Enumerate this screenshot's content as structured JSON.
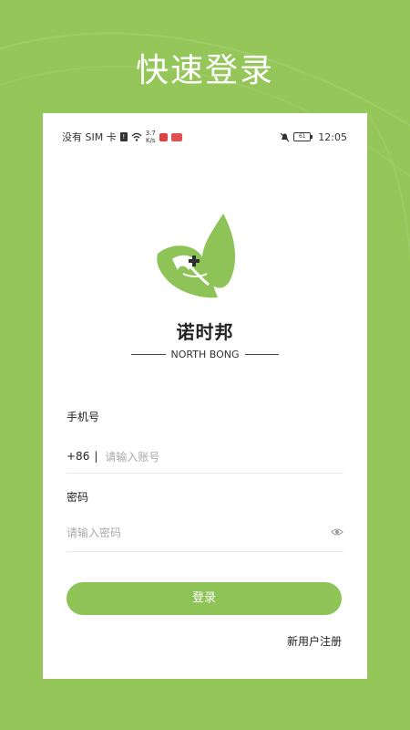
{
  "header": {
    "title": "快速登录"
  },
  "status_bar": {
    "carrier": "没有 SIM 卡",
    "speed_top": "3.7",
    "speed_bottom": "K/s",
    "battery": "61",
    "time": "12:05"
  },
  "brand": {
    "name_cn": "诺时邦",
    "name_en": "NORTH BONG"
  },
  "form": {
    "phone_label": "手机号",
    "country_code": "+86",
    "phone_placeholder": "请输入账号",
    "password_label": "密码",
    "password_placeholder": "请输入密码"
  },
  "actions": {
    "login_label": "登录",
    "register_label": "新用户注册"
  },
  "colors": {
    "background": "#95c65a",
    "accent": "#8dc357",
    "card": "#ffffff"
  }
}
